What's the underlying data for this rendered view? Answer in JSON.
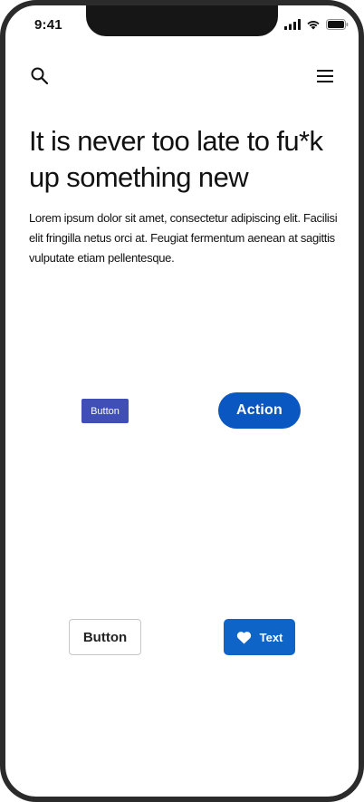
{
  "status_bar": {
    "time": "9:41",
    "icons": [
      "signal-icon",
      "wifi-icon",
      "battery-icon"
    ]
  },
  "top_bar": {
    "search_icon": "search-icon",
    "menu_icon": "hamburger-menu-icon"
  },
  "content": {
    "headline": "It is never too late to fu*k up something new",
    "body": "Lorem ipsum dolor sit amet, consectetur adipiscing elit. Facilisi elit fringilla netus orci at. Feugiat fermentum aenean at sagittis vulputate etiam pellentesque."
  },
  "buttons": {
    "small_label": "Button",
    "action_label": "Action",
    "outline_label": "Button",
    "icon_text_label": "Text",
    "icon_text_icon": "heart-icon"
  },
  "colors": {
    "small_button": "#3f4fb5",
    "action_button": "#0a57c2",
    "icon_text_button": "#0f64c8",
    "frame": "#2b2b2b",
    "notch": "#161616"
  }
}
